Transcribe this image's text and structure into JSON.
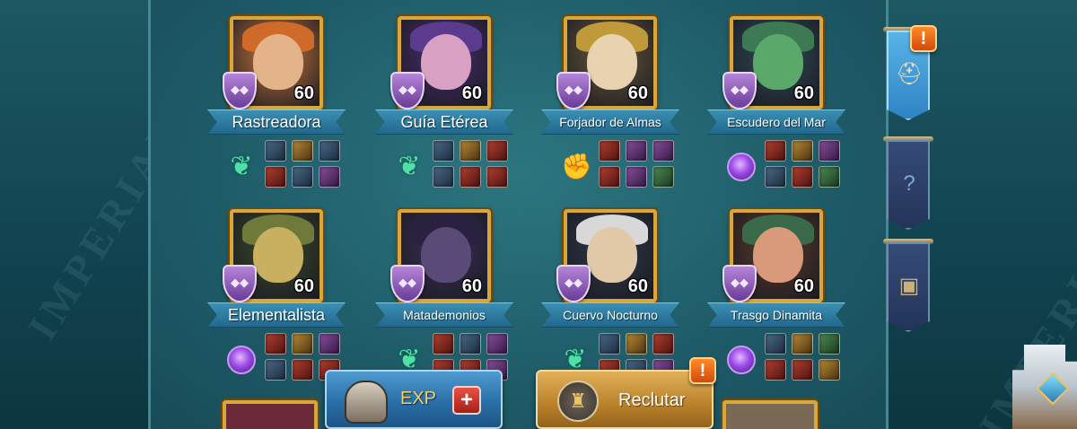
{
  "watermark": "IMPERIAL STORE",
  "heroes": [
    {
      "name": "Rastreadora",
      "level": "60",
      "type": "green",
      "name_size": "big",
      "portrait_bg": "#c9773c",
      "face": "#e3b48a",
      "hat": "#d06a2a",
      "gear": [
        "blue",
        "gold",
        "blue",
        "red",
        "blue",
        "purple"
      ]
    },
    {
      "name": "Guía Etérea",
      "level": "60",
      "type": "green",
      "name_size": "big",
      "portrait_bg": "#4a2d6e",
      "face": "#d8a0c2",
      "hat": "#5a3b8e",
      "gear": [
        "blue",
        "gold",
        "red",
        "blue",
        "red",
        "red"
      ]
    },
    {
      "name": "Forjador de Almas",
      "level": "60",
      "type": "fist",
      "name_size": "small",
      "portrait_bg": "#6a5a3a",
      "face": "#e8d2b0",
      "hat": "#c09a3a",
      "gear": [
        "red",
        "purple",
        "purple",
        "red",
        "purple",
        "green"
      ]
    },
    {
      "name": "Escudero del Mar",
      "level": "60",
      "type": "purple",
      "name_size": "small",
      "portrait_bg": "#2f4a58",
      "face": "#5aa86a",
      "hat": "#3d7a54",
      "gear": [
        "red",
        "gold",
        "purple",
        "blue",
        "red",
        "green"
      ]
    },
    {
      "name": "Elementalista",
      "level": "60",
      "type": "purple",
      "name_size": "big",
      "portrait_bg": "#3a4a2a",
      "face": "#c9b060",
      "hat": "#6f7a3a",
      "gear": [
        "red",
        "gold",
        "purple",
        "blue",
        "red",
        "red"
      ]
    },
    {
      "name": "Matademonios",
      "level": "60",
      "type": "green",
      "name_size": "small",
      "portrait_bg": "#3c2f56",
      "face": "#5a4a78",
      "hat": "#2a2040",
      "gear": [
        "red",
        "blue",
        "purple",
        "red",
        "red",
        "purple"
      ]
    },
    {
      "name": "Cuervo Nocturno",
      "level": "60",
      "type": "green",
      "name_size": "small",
      "portrait_bg": "#2e3a4a",
      "face": "#e0c8a8",
      "hat": "#d8d8d8",
      "gear": [
        "blue",
        "gold",
        "red",
        "red",
        "blue",
        "purple"
      ]
    },
    {
      "name": "Trasgo Dinamita",
      "level": "60",
      "type": "purple",
      "name_size": "small",
      "portrait_bg": "#5a3a2a",
      "face": "#d89a7a",
      "hat": "#3a6a4a",
      "gear": [
        "blue",
        "gold",
        "green",
        "red",
        "red",
        "gold"
      ]
    }
  ],
  "buttons": {
    "exp_label": "EXP",
    "exp_plus": "+",
    "recruit_label": "Reclutar",
    "alert_mark": "!"
  },
  "side_tabs": [
    {
      "icon": "viking-helmet-icon",
      "glyph": "⛑",
      "active": true
    },
    {
      "icon": "mystery-hero-icon",
      "glyph": "?",
      "active": false
    },
    {
      "icon": "treasure-chest-icon",
      "glyph": "▣",
      "active": false
    }
  ],
  "colors": {
    "frame_gold": "#d9a63a",
    "ribbon_blue": "#2f7fa8",
    "panel_teal": "#24616d",
    "exp_blue": "#3a86c0",
    "recruit_gold": "#d19a42",
    "alert_orange": "#f06a1a"
  }
}
